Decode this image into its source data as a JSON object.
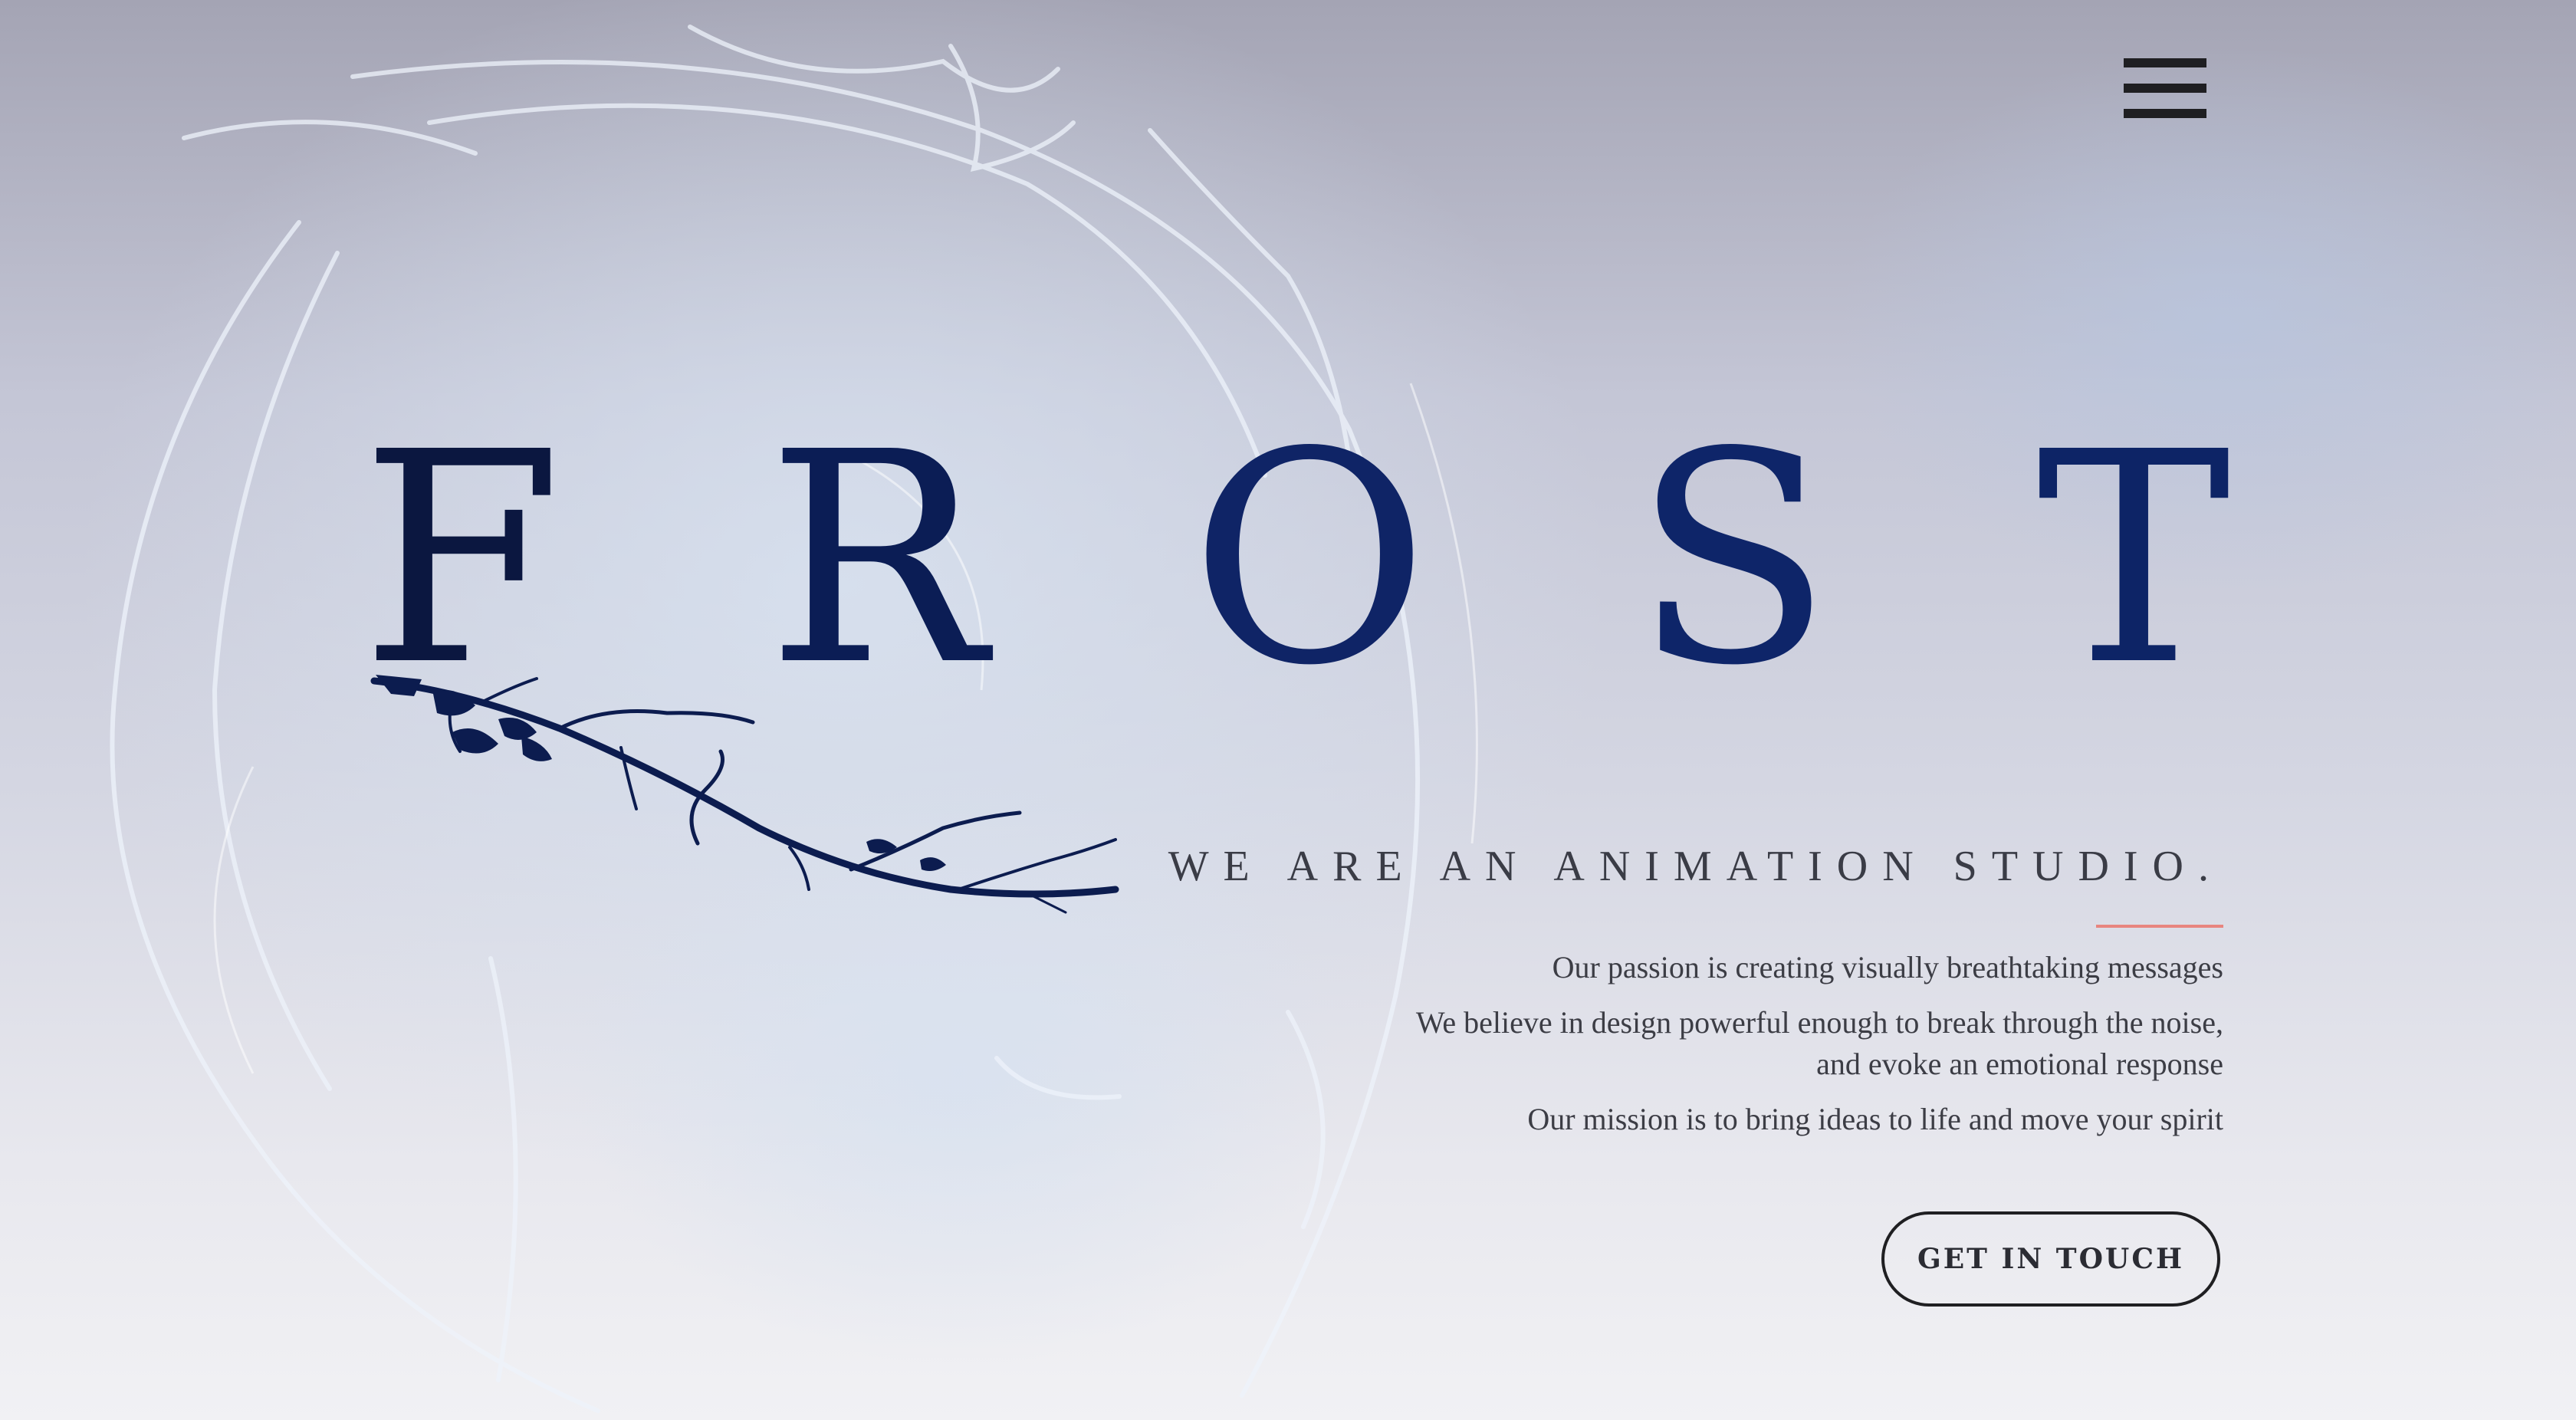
{
  "header": {
    "menu_icon": "hamburger-menu-icon"
  },
  "hero": {
    "brand_letters": [
      "F",
      "R",
      "O",
      "S",
      "T"
    ],
    "tagline": "WE ARE AN ANIMATION STUDIO.",
    "paragraphs": [
      "Our passion is creating visually breathtaking messages",
      "We believe in design powerful enough to break through the noise, and evoke an emotional response",
      "Our mission is to bring ideas to life and move your spirit"
    ],
    "cta_label": "GET IN TOUCH"
  },
  "colors": {
    "brand_navy": "#0d2166",
    "accent_rule": "#e8857f",
    "text_dark": "#3a3c46"
  }
}
